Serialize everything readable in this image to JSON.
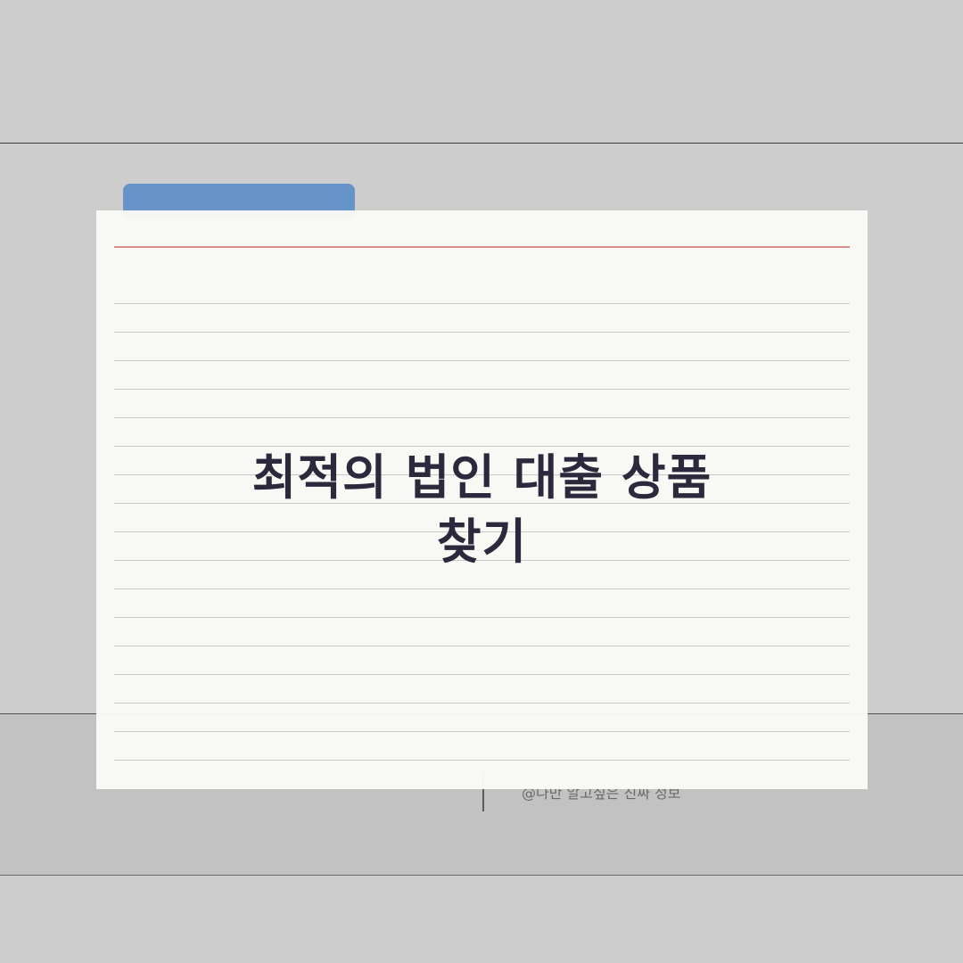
{
  "card": {
    "title_line1": "최적의 법인 대출 상품",
    "title_line2": "찾기"
  },
  "footer": {
    "caption": "@나만 알고싶은 진짜 정보"
  },
  "colors": {
    "background": "#cdcdcd",
    "folder_tab": "#6694c9",
    "card_paper": "#fafaf6",
    "margin_rule": "#d98c8c",
    "line_rule": "#c8c8c8",
    "title_text": "#2a2a3c"
  }
}
